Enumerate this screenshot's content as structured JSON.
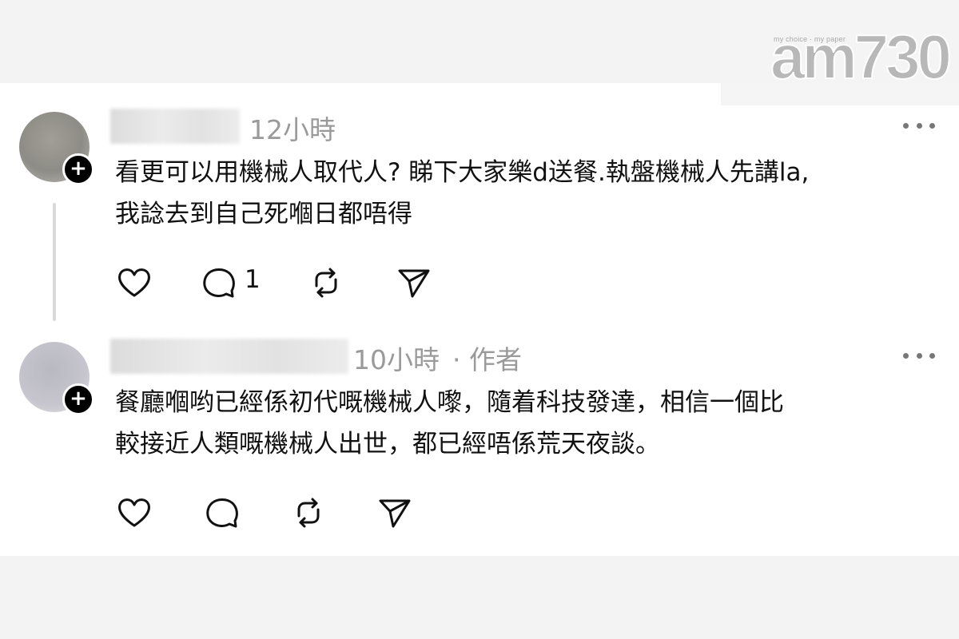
{
  "header": {
    "logo_tagline": "my choice · my paper",
    "logo_text": "am730"
  },
  "posts": [
    {
      "time": "12小時",
      "author_tag": "",
      "text_lines": [
        "看更可以用機械人取代人? 睇下大家樂d送餐.執盤機械人先講la,",
        "我諗去到自己死嗰日都唔得"
      ],
      "reply_count": "1",
      "follow_symbol": "+"
    },
    {
      "time": "10小時",
      "author_tag": "· 作者",
      "text_lines": [
        "餐廳嗰哟已經係初代嘅機械人嚟，隨着科技發達，相信一個比",
        "較接近人類嘅機械人出世，都已經唔係荒天夜談。"
      ],
      "reply_count": "",
      "follow_symbol": "+"
    }
  ],
  "icons": {
    "like": "heart-icon",
    "reply": "comment-icon",
    "repost": "repost-icon",
    "share": "send-icon",
    "more": "more-icon"
  },
  "colors": {
    "background": "#f3f3f3",
    "card": "#ffffff",
    "meta_text": "#9a9a9a",
    "body_text": "#111111"
  }
}
